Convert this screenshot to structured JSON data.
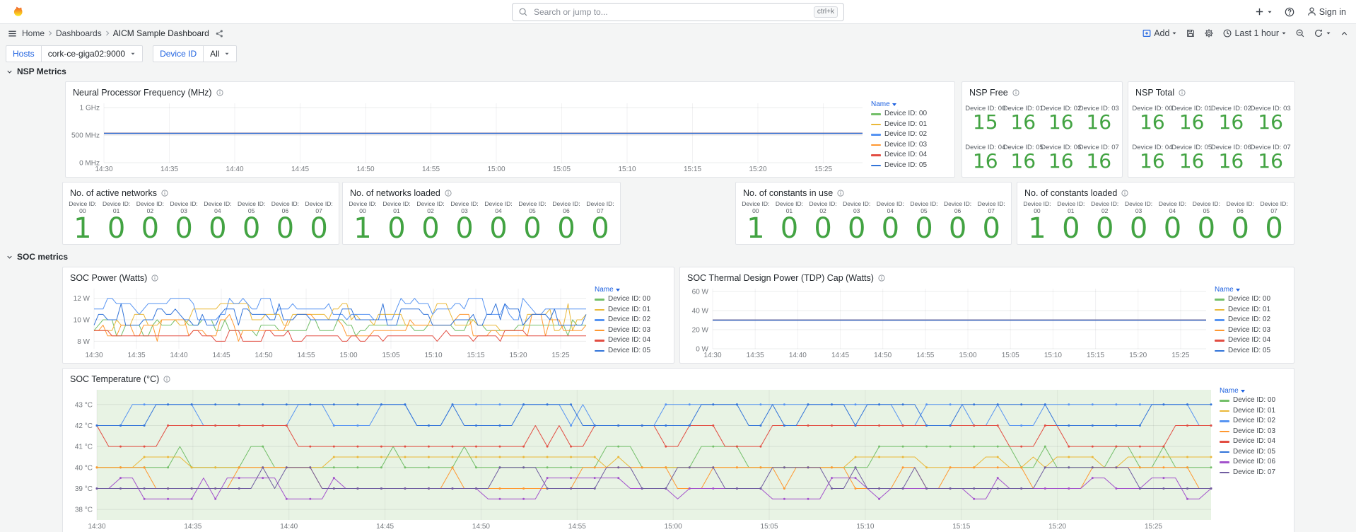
{
  "app": {
    "brand": "Grafana",
    "nav": {
      "search_placeholder": "Search or jump to...",
      "search_shortcut": "ctrl+k",
      "sign_in": "Sign in"
    },
    "breadcrumb": {
      "items": [
        "Home",
        "Dashboards",
        "AICM Sample Dashboard"
      ]
    },
    "toolbar": {
      "add_label": "Add",
      "time_range": "Last 1 hour"
    }
  },
  "variables": [
    {
      "label": "Hosts",
      "value": "cork-ce-giga02:9000"
    },
    {
      "label": "Device ID",
      "value": "All"
    }
  ],
  "rows": [
    {
      "title": "NSP Metrics"
    },
    {
      "title": "SOC metrics"
    }
  ],
  "legend_header": "Name",
  "colors": {
    "stat_green": "#42a342",
    "accent_blue": "#1f62e0",
    "palette": [
      "#73BF69",
      "#EAB839",
      "#5794F2",
      "#FF9830",
      "#E24D42",
      "#3274D9",
      "#A352CC",
      "#705DA0"
    ]
  },
  "chart_data": {
    "freq": {
      "type": "line",
      "title": "Neural Processor Frequency (MHz)",
      "x_ticks": [
        "14:30",
        "14:35",
        "14:40",
        "14:45",
        "14:50",
        "14:55",
        "15:00",
        "15:05",
        "15:10",
        "15:15",
        "15:20",
        "15:25"
      ],
      "x_minutes": 58,
      "ylim": [
        0,
        1080
      ],
      "pad_l": 50,
      "y_ticks": [
        {
          "v": 0,
          "label": "0 MHz"
        },
        {
          "v": 500,
          "label": "500 MHz"
        },
        {
          "v": 1000,
          "label": "1 GHz"
        }
      ],
      "series": [
        {
          "name": "Device ID: 00",
          "color": "#73BF69",
          "flat": 533
        },
        {
          "name": "Device ID: 01",
          "color": "#EAB839",
          "flat": 533
        },
        {
          "name": "Device ID: 02",
          "color": "#5794F2",
          "flat": 533
        },
        {
          "name": "Device ID: 03",
          "color": "#FF9830",
          "flat": 533
        },
        {
          "name": "Device ID: 04",
          "color": "#E24D42",
          "flat": 533
        },
        {
          "name": "Device ID: 05",
          "color": "#3274D9",
          "flat": 533
        }
      ]
    },
    "power": {
      "type": "line",
      "title": "SOC Power (Watts)",
      "x_ticks": [
        "14:30",
        "14:35",
        "14:40",
        "14:45",
        "14:50",
        "14:55",
        "15:00",
        "15:05",
        "15:10",
        "15:15",
        "15:20",
        "15:25"
      ],
      "x_minutes": 58,
      "ylim": [
        7.3,
        12.9
      ],
      "pad_l": 40,
      "y_ticks": [
        {
          "v": 8,
          "label": "8 W"
        },
        {
          "v": 10,
          "label": "10 W"
        },
        {
          "v": 12,
          "label": "12 W"
        }
      ],
      "series": [
        {
          "name": "Device ID: 00",
          "color": "#73BF69",
          "min": 8.5,
          "max": 10,
          "quant": 0.5,
          "seed": 11
        },
        {
          "name": "Device ID: 01",
          "color": "#EAB839",
          "min": 9,
          "max": 11.5,
          "quant": 0.5,
          "seed": 22
        },
        {
          "name": "Device ID: 02",
          "color": "#5794F2",
          "min": 10,
          "max": 12,
          "quant": 0.5,
          "seed": 33
        },
        {
          "name": "Device ID: 03",
          "color": "#FF9830",
          "min": 8,
          "max": 10.5,
          "quant": 0.5,
          "seed": 44
        },
        {
          "name": "Device ID: 04",
          "color": "#E24D42",
          "min": 8,
          "max": 9,
          "quant": 0.5,
          "seed": 55
        },
        {
          "name": "Device ID: 05",
          "color": "#3274D9",
          "min": 9.5,
          "max": 11.5,
          "quant": 0.5,
          "seed": 66
        }
      ]
    },
    "tdp": {
      "type": "line",
      "title": "SOC Thermal Design Power (TDP) Cap (Watts)",
      "x_ticks": [
        "14:30",
        "14:35",
        "14:40",
        "14:45",
        "14:50",
        "14:55",
        "15:00",
        "15:05",
        "15:10",
        "15:15",
        "15:20",
        "15:25"
      ],
      "x_minutes": 58,
      "ylim": [
        0,
        63
      ],
      "pad_l": 42,
      "y_ticks": [
        {
          "v": 0,
          "label": "0 W"
        },
        {
          "v": 20,
          "label": "20 W"
        },
        {
          "v": 40,
          "label": "40 W"
        },
        {
          "v": 60,
          "label": "60 W"
        }
      ],
      "series": [
        {
          "name": "Device ID: 00",
          "color": "#73BF69",
          "flat": 30
        },
        {
          "name": "Device ID: 01",
          "color": "#EAB839",
          "flat": 30
        },
        {
          "name": "Device ID: 02",
          "color": "#5794F2",
          "flat": 30
        },
        {
          "name": "Device ID: 03",
          "color": "#FF9830",
          "flat": 30
        },
        {
          "name": "Device ID: 04",
          "color": "#E24D42",
          "flat": 30
        },
        {
          "name": "Device ID: 05",
          "color": "#3274D9",
          "flat": 30
        }
      ]
    },
    "temp": {
      "type": "line",
      "title": "SOC Temperature (°C)",
      "x_ticks": [
        "14:30",
        "14:35",
        "14:40",
        "14:45",
        "14:50",
        "14:55",
        "15:00",
        "15:05",
        "15:10",
        "15:15",
        "15:20",
        "15:25"
      ],
      "x_minutes": 58,
      "ylim": [
        37.5,
        43.7
      ],
      "pad_l": 44,
      "plot_bg": "#e8f3e4",
      "markers": true,
      "points": 95,
      "y_ticks": [
        {
          "v": 38,
          "label": "38 °C"
        },
        {
          "v": 39,
          "label": "39 °C"
        },
        {
          "v": 40,
          "label": "40 °C"
        },
        {
          "v": 41,
          "label": "41 °C"
        },
        {
          "v": 42,
          "label": "42 °C"
        },
        {
          "v": 43,
          "label": "43 °C"
        }
      ],
      "series": [
        {
          "name": "Device ID: 00",
          "color": "#73BF69",
          "min": 40,
          "max": 41,
          "quant": 1,
          "seed": 7
        },
        {
          "name": "Device ID: 01",
          "color": "#EAB839",
          "min": 40,
          "max": 40.5,
          "quant": 0.5,
          "seed": 8
        },
        {
          "name": "Device ID: 02",
          "color": "#5794F2",
          "min": 42,
          "max": 43,
          "quant": 1,
          "seed": 9
        },
        {
          "name": "Device ID: 03",
          "color": "#FF9830",
          "min": 39,
          "max": 40,
          "quant": 1,
          "seed": 10
        },
        {
          "name": "Device ID: 04",
          "color": "#E24D42",
          "min": 41,
          "max": 42,
          "quant": 1,
          "seed": 12
        },
        {
          "name": "Device ID: 05",
          "color": "#3274D9",
          "min": 42,
          "max": 43,
          "quant": 1,
          "seed": 13
        },
        {
          "name": "Device ID: 06",
          "color": "#A352CC",
          "min": 38.5,
          "max": 39.5,
          "quant": 0.5,
          "seed": 14
        },
        {
          "name": "Device ID: 07",
          "color": "#705DA0",
          "min": 39,
          "max": 40,
          "quant": 1,
          "seed": 15
        }
      ]
    }
  },
  "stats": {
    "nsp_free": {
      "title": "NSP Free",
      "cells": [
        {
          "label": "Device ID: 00",
          "value": "15"
        },
        {
          "label": "Device ID: 01",
          "value": "16"
        },
        {
          "label": "Device ID: 02",
          "value": "16"
        },
        {
          "label": "Device ID: 03",
          "value": "16"
        },
        {
          "label": "Device ID: 04",
          "value": "16"
        },
        {
          "label": "Device ID: 05",
          "value": "16"
        },
        {
          "label": "Device ID: 06",
          "value": "16"
        },
        {
          "label": "Device ID: 07",
          "value": "16"
        }
      ]
    },
    "nsp_total": {
      "title": "NSP Total",
      "cells": [
        {
          "label": "Device ID: 00",
          "value": "16"
        },
        {
          "label": "Device ID: 01",
          "value": "16"
        },
        {
          "label": "Device ID: 02",
          "value": "16"
        },
        {
          "label": "Device ID: 03",
          "value": "16"
        },
        {
          "label": "Device ID: 04",
          "value": "16"
        },
        {
          "label": "Device ID: 05",
          "value": "16"
        },
        {
          "label": "Device ID: 06",
          "value": "16"
        },
        {
          "label": "Device ID: 07",
          "value": "16"
        }
      ]
    },
    "active_networks": {
      "title": "No. of active networks",
      "cells": [
        {
          "label": "Device ID: 00",
          "value": "1"
        },
        {
          "label": "Device ID: 01",
          "value": "0"
        },
        {
          "label": "Device ID: 02",
          "value": "0"
        },
        {
          "label": "Device ID: 03",
          "value": "0"
        },
        {
          "label": "Device ID: 04",
          "value": "0"
        },
        {
          "label": "Device ID: 05",
          "value": "0"
        },
        {
          "label": "Device ID: 06",
          "value": "0"
        },
        {
          "label": "Device ID: 07",
          "value": "0"
        }
      ]
    },
    "networks_loaded": {
      "title": "No. of networks loaded",
      "cells": [
        {
          "label": "Device ID: 00",
          "value": "1"
        },
        {
          "label": "Device ID: 01",
          "value": "0"
        },
        {
          "label": "Device ID: 02",
          "value": "0"
        },
        {
          "label": "Device ID: 03",
          "value": "0"
        },
        {
          "label": "Device ID: 04",
          "value": "0"
        },
        {
          "label": "Device ID: 05",
          "value": "0"
        },
        {
          "label": "Device ID: 06",
          "value": "0"
        },
        {
          "label": "Device ID: 07",
          "value": "0"
        }
      ]
    },
    "constants_in_use": {
      "title": "No. of constants in use",
      "cells": [
        {
          "label": "Device ID: 00",
          "value": "1"
        },
        {
          "label": "Device ID: 01",
          "value": "0"
        },
        {
          "label": "Device ID: 02",
          "value": "0"
        },
        {
          "label": "Device ID: 03",
          "value": "0"
        },
        {
          "label": "Device ID: 04",
          "value": "0"
        },
        {
          "label": "Device ID: 05",
          "value": "0"
        },
        {
          "label": "Device ID: 06",
          "value": "0"
        },
        {
          "label": "Device ID: 07",
          "value": "0"
        }
      ]
    },
    "constants_loaded": {
      "title": "No. of constants loaded",
      "cells": [
        {
          "label": "Device ID: 00",
          "value": "1"
        },
        {
          "label": "Device ID: 01",
          "value": "0"
        },
        {
          "label": "Device ID: 02",
          "value": "0"
        },
        {
          "label": "Device ID: 03",
          "value": "0"
        },
        {
          "label": "Device ID: 04",
          "value": "0"
        },
        {
          "label": "Device ID: 05",
          "value": "0"
        },
        {
          "label": "Device ID: 06",
          "value": "0"
        },
        {
          "label": "Device ID: 07",
          "value": "0"
        }
      ]
    }
  }
}
